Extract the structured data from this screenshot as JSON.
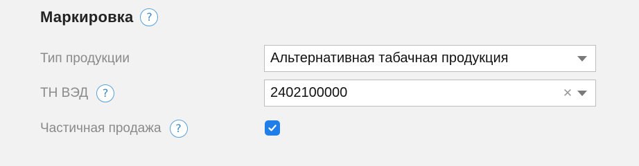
{
  "section": {
    "title": "Маркировка",
    "help_glyph": "?"
  },
  "fields": {
    "product_type": {
      "label": "Тип продукции",
      "value": "Альтернативная табачная продукция"
    },
    "tn_ved": {
      "label": "ТН ВЭД",
      "help_glyph": "?",
      "value": "2402100000",
      "clear_glyph": "✕"
    },
    "partial_sale": {
      "label": "Частичная продажа",
      "help_glyph": "?",
      "checked": true
    }
  },
  "colors": {
    "accent": "#1f7ee8",
    "help_border": "#5aa0d6",
    "background": "#f2f2f2",
    "label": "#8a8a8a"
  },
  "icons": {
    "help": "question-circle-icon",
    "dropdown": "chevron-down-icon",
    "clear": "close-icon",
    "check": "checkmark-icon"
  }
}
